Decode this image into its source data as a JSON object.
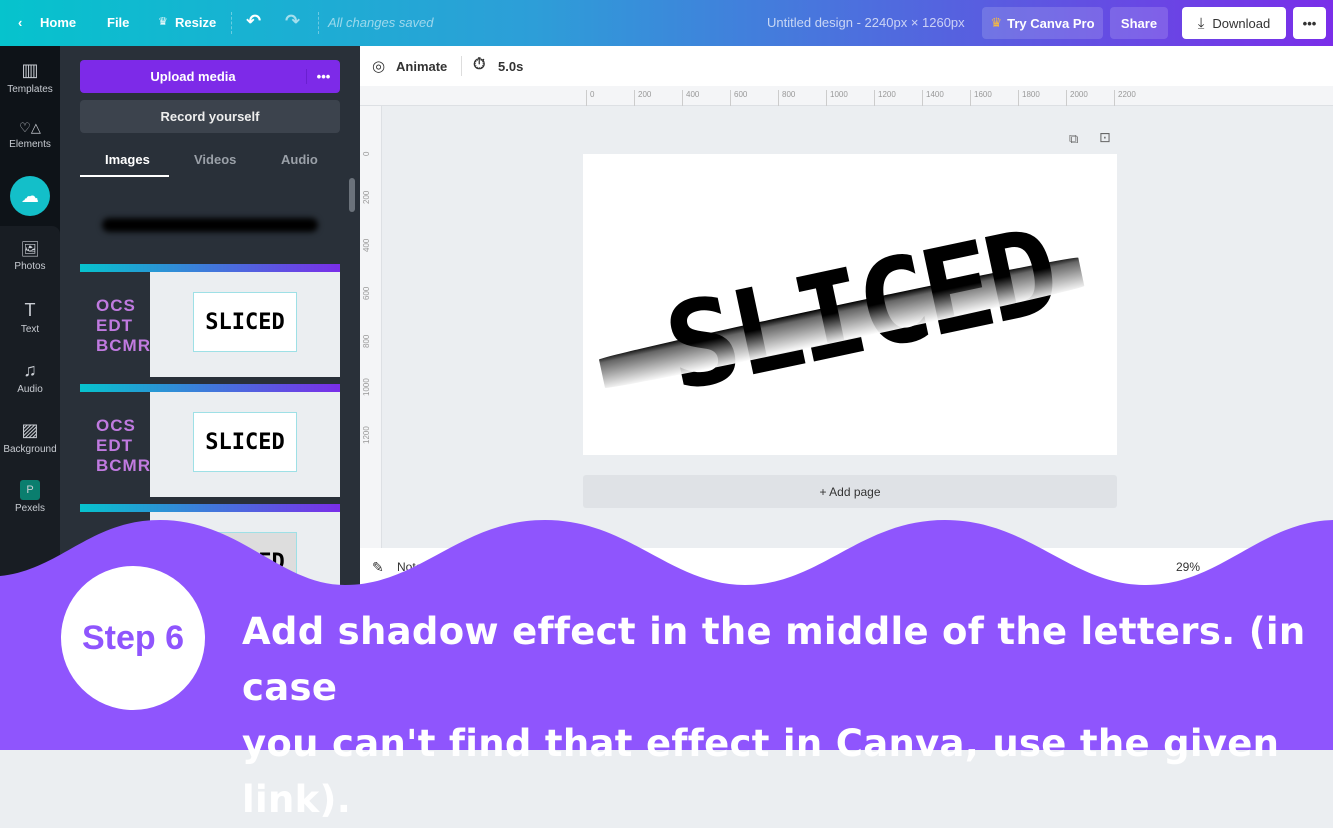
{
  "topbar": {
    "home": "Home",
    "file": "File",
    "resize": "Resize",
    "status": "All changes saved",
    "title": "Untitled design - 2240px × 1260px",
    "try_pro": "Try Canva Pro",
    "share": "Share",
    "download": "Download",
    "more": "•••"
  },
  "rail": [
    {
      "label": "Templates",
      "icon": "▥"
    },
    {
      "label": "Elements",
      "icon": "♡△"
    },
    {
      "label": "Uploads",
      "icon": "☁"
    },
    {
      "label": "Photos",
      "icon": "🖼"
    },
    {
      "label": "Text",
      "icon": "T"
    },
    {
      "label": "Audio",
      "icon": "♫"
    },
    {
      "label": "Background",
      "icon": "▨"
    },
    {
      "label": "Pexels",
      "icon": "P"
    }
  ],
  "panel": {
    "upload": "Upload media",
    "more": "•••",
    "record": "Record yourself",
    "tabs": [
      "Images",
      "Videos",
      "Audio"
    ],
    "thumb_text": "SLICED",
    "thumb_letters": "OCS EDT BCMR"
  },
  "toolbar": {
    "animate": "Animate",
    "duration": "5.0s"
  },
  "ruler": {
    "h": [
      "0",
      "200",
      "400",
      "600",
      "800",
      "1000",
      "1200",
      "1400",
      "1600",
      "1800",
      "2000",
      "2200"
    ],
    "v": [
      "0",
      "200",
      "400",
      "600",
      "800",
      "1000",
      "1200"
    ]
  },
  "canvas": {
    "text": "SLICED",
    "add_page": "+ Add page"
  },
  "bottom": {
    "notes": "Notes",
    "zoom": "29%"
  },
  "overlay": {
    "step": "Step 6",
    "line1": "Add shadow effect in the middle of the letters. (in case",
    "line2": "you can't find that effect in Canva, use the given link).",
    "color": "#8f55fd"
  }
}
